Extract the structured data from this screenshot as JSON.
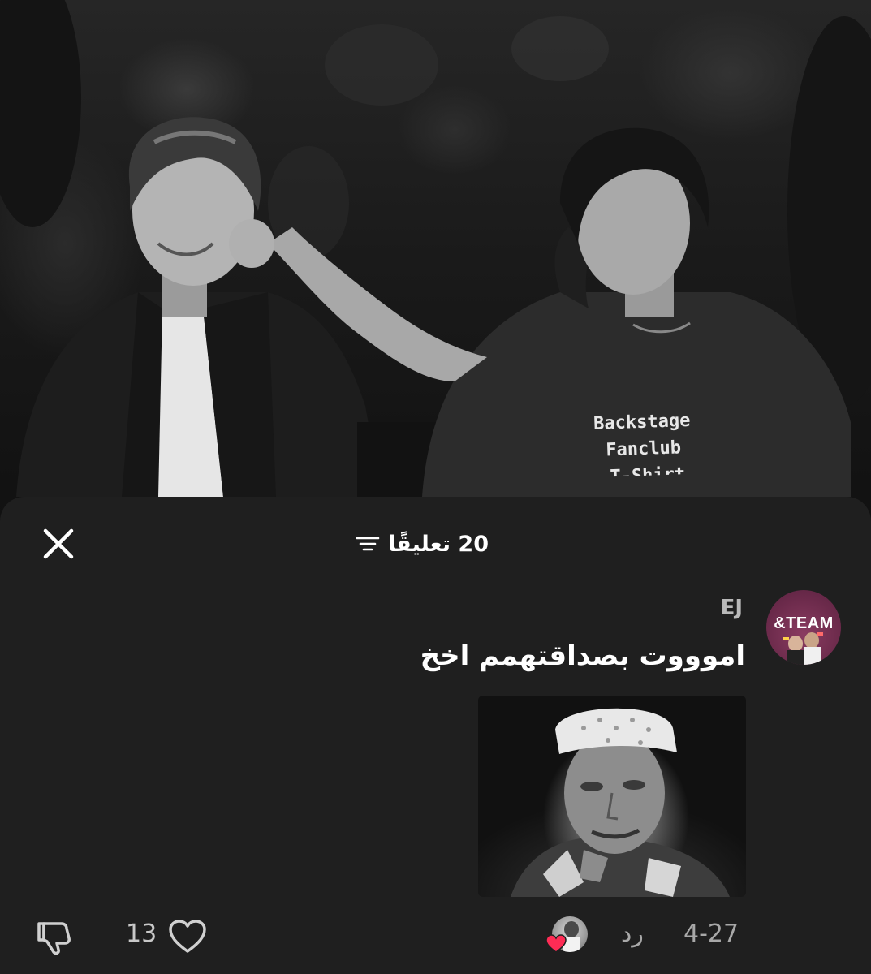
{
  "video": {
    "shirt_text_lines": [
      "Backstage",
      "Fanclub",
      "T-Shirt"
    ]
  },
  "comments_panel": {
    "title": "20 تعليقًا",
    "icons": {
      "close": "close-icon",
      "sort": "filter-lines-icon"
    }
  },
  "comment": {
    "avatar_label": "&TEAM",
    "username": "EJ",
    "text": "اموووت بصداقتهمم اخخ",
    "image": "man-in-white-cap-sticker",
    "date": "4-27",
    "reply_label": "رد",
    "like_count": "13",
    "creator_liked": true,
    "icons": {
      "dislike": "thumbs-down-icon",
      "like": "heart-outline-icon",
      "creator_like": "heart-filled-icon"
    }
  },
  "colors": {
    "sheet_background": "#1f1f1f",
    "creator_heart": "#fe2c55",
    "avatar_background": "#7a3355"
  }
}
